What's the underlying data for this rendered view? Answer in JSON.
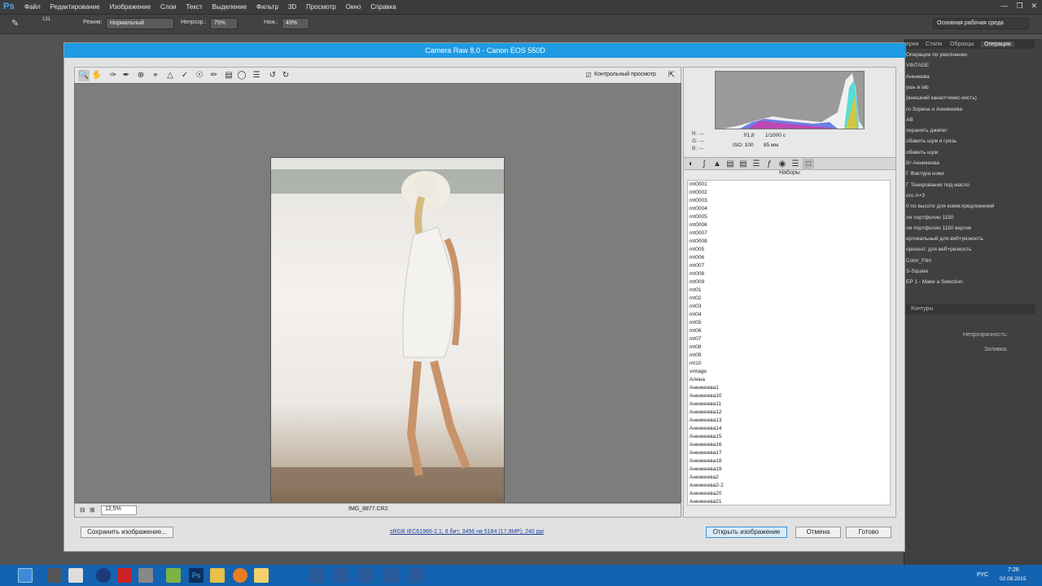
{
  "app": {
    "logo": "Ps"
  },
  "menu": [
    "Файл",
    "Редактирование",
    "Изображение",
    "Слои",
    "Текст",
    "Выделение",
    "Фильтр",
    "3D",
    "Просмотр",
    "Окно",
    "Справка"
  ],
  "options": {
    "mode_label": "Режим:",
    "mode_value": "Нормальный",
    "opacity_label": "Непрозр.:",
    "opacity_value": "75%",
    "press_label": "Наж.:",
    "press_value": "49%",
    "brush_size": "131",
    "workspace": "Основная рабочая среда"
  },
  "panels": {
    "tabs": [
      "ерия",
      "Стили",
      "Образцы",
      "Операции"
    ],
    "actions": [
      "Операции по умолчанию",
      "VINTAGE",
      "Анникева",
      "ушь в lab",
      "(внешний канал+микс-кисть)",
      "го Зорина и Анникеева",
      "АВ",
      "охранить джипег",
      "обавить шум и грязь",
      "обавить шум",
      "йт Анникеева",
      "Г Фактура кожи",
      "Г Тонирование под масло",
      "ого A+3",
      "0 по высоте для комм.предложений",
      "ля портфолио 1150",
      "ля портфолио 1150 вертик",
      "ертикальный для веб+резкость",
      "оризонт. для веб+резкость",
      "Color_Film",
      "S-Square",
      "EP 1 - Make a Selection"
    ],
    "contours": "Контуры",
    "opacity2": "Непрозрачность:",
    "fill": "Заливка:"
  },
  "dialog": {
    "title": "Camera Raw 8.0  -  Canon EOS 550D",
    "preview_check": "Контрольный просмотр",
    "zoom": "12,5%",
    "filename": "IMG_8877.CR2",
    "histo": {
      "r": "R:   ---",
      "g": "G:   ---",
      "b": "B:   ---",
      "aperture": "f/1,8",
      "shutter": "1/1000 с",
      "iso": "ISO: 100",
      "focal": "85 мм"
    },
    "presets_title": "Наборы",
    "presets": [
      "mt0001",
      "mt0002",
      "mt0003",
      "mt0004",
      "mt0005",
      "mt0006",
      "mt0007",
      "mt0008",
      "mt005",
      "mt006",
      "mt007",
      "mt008",
      "mt009",
      "mt01",
      "mt02",
      "mt03",
      "mt04",
      "mt05",
      "mt06",
      "mt07",
      "mt08",
      "mt09",
      "mt10",
      "vintage",
      "Алина",
      "Анникеева1",
      "Анникеева10",
      "Анникеева11",
      "Анникеева12",
      "Анникеева13",
      "Анникеева14",
      "Анникеева15",
      "Анникеева16",
      "Анникеева17",
      "Анникеева18",
      "Анникеева19",
      "Анникеева2",
      "Анникеева2-2",
      "Анникеева20",
      "Анникеева21"
    ],
    "save_btn": "Сохранить изображение...",
    "workflow": "sRGB IEC61966-2.1; 8 бит; 3456 на 5184 (17,9МР); 240 ppi",
    "open_btn": "Открыть изображение",
    "cancel_btn": "Отмена",
    "done_btn": "Готово"
  },
  "taskbar": {
    "lang": "РУС",
    "time": "7:26",
    "date": "02.08.2015"
  }
}
